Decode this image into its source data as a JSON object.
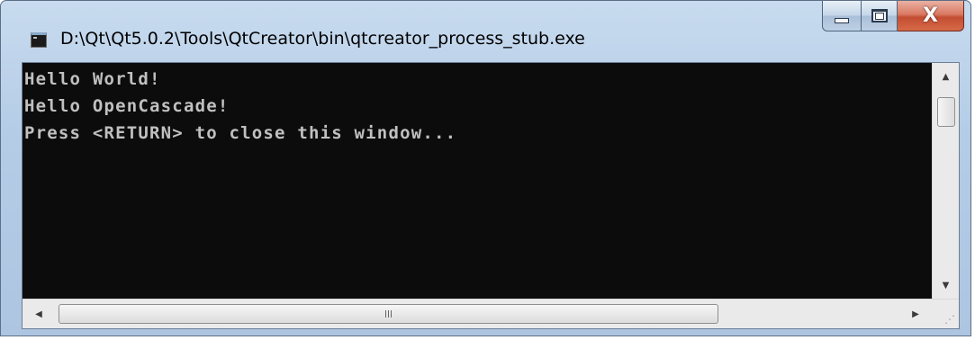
{
  "window": {
    "title": "D:\\Qt\\Qt5.0.2\\Tools\\QtCreator\\bin\\qtcreator_process_stub.exe",
    "icon": "console-app-icon",
    "caption_buttons": {
      "minimize_icon": "minimize-icon",
      "maximize_icon": "maximize-icon",
      "close_icon": "close-icon",
      "close_glyph": "X"
    }
  },
  "console": {
    "lines": [
      "Hello World!",
      "Hello OpenCascade!",
      "Press <RETURN> to close this window..."
    ],
    "background_color": "#0c0c0c",
    "text_color": "#c0c0c0"
  },
  "scrollbars": {
    "vertical": {
      "up_glyph": "▲",
      "down_glyph": "▼"
    },
    "horizontal": {
      "left_glyph": "◀",
      "right_glyph": "▶"
    }
  }
}
